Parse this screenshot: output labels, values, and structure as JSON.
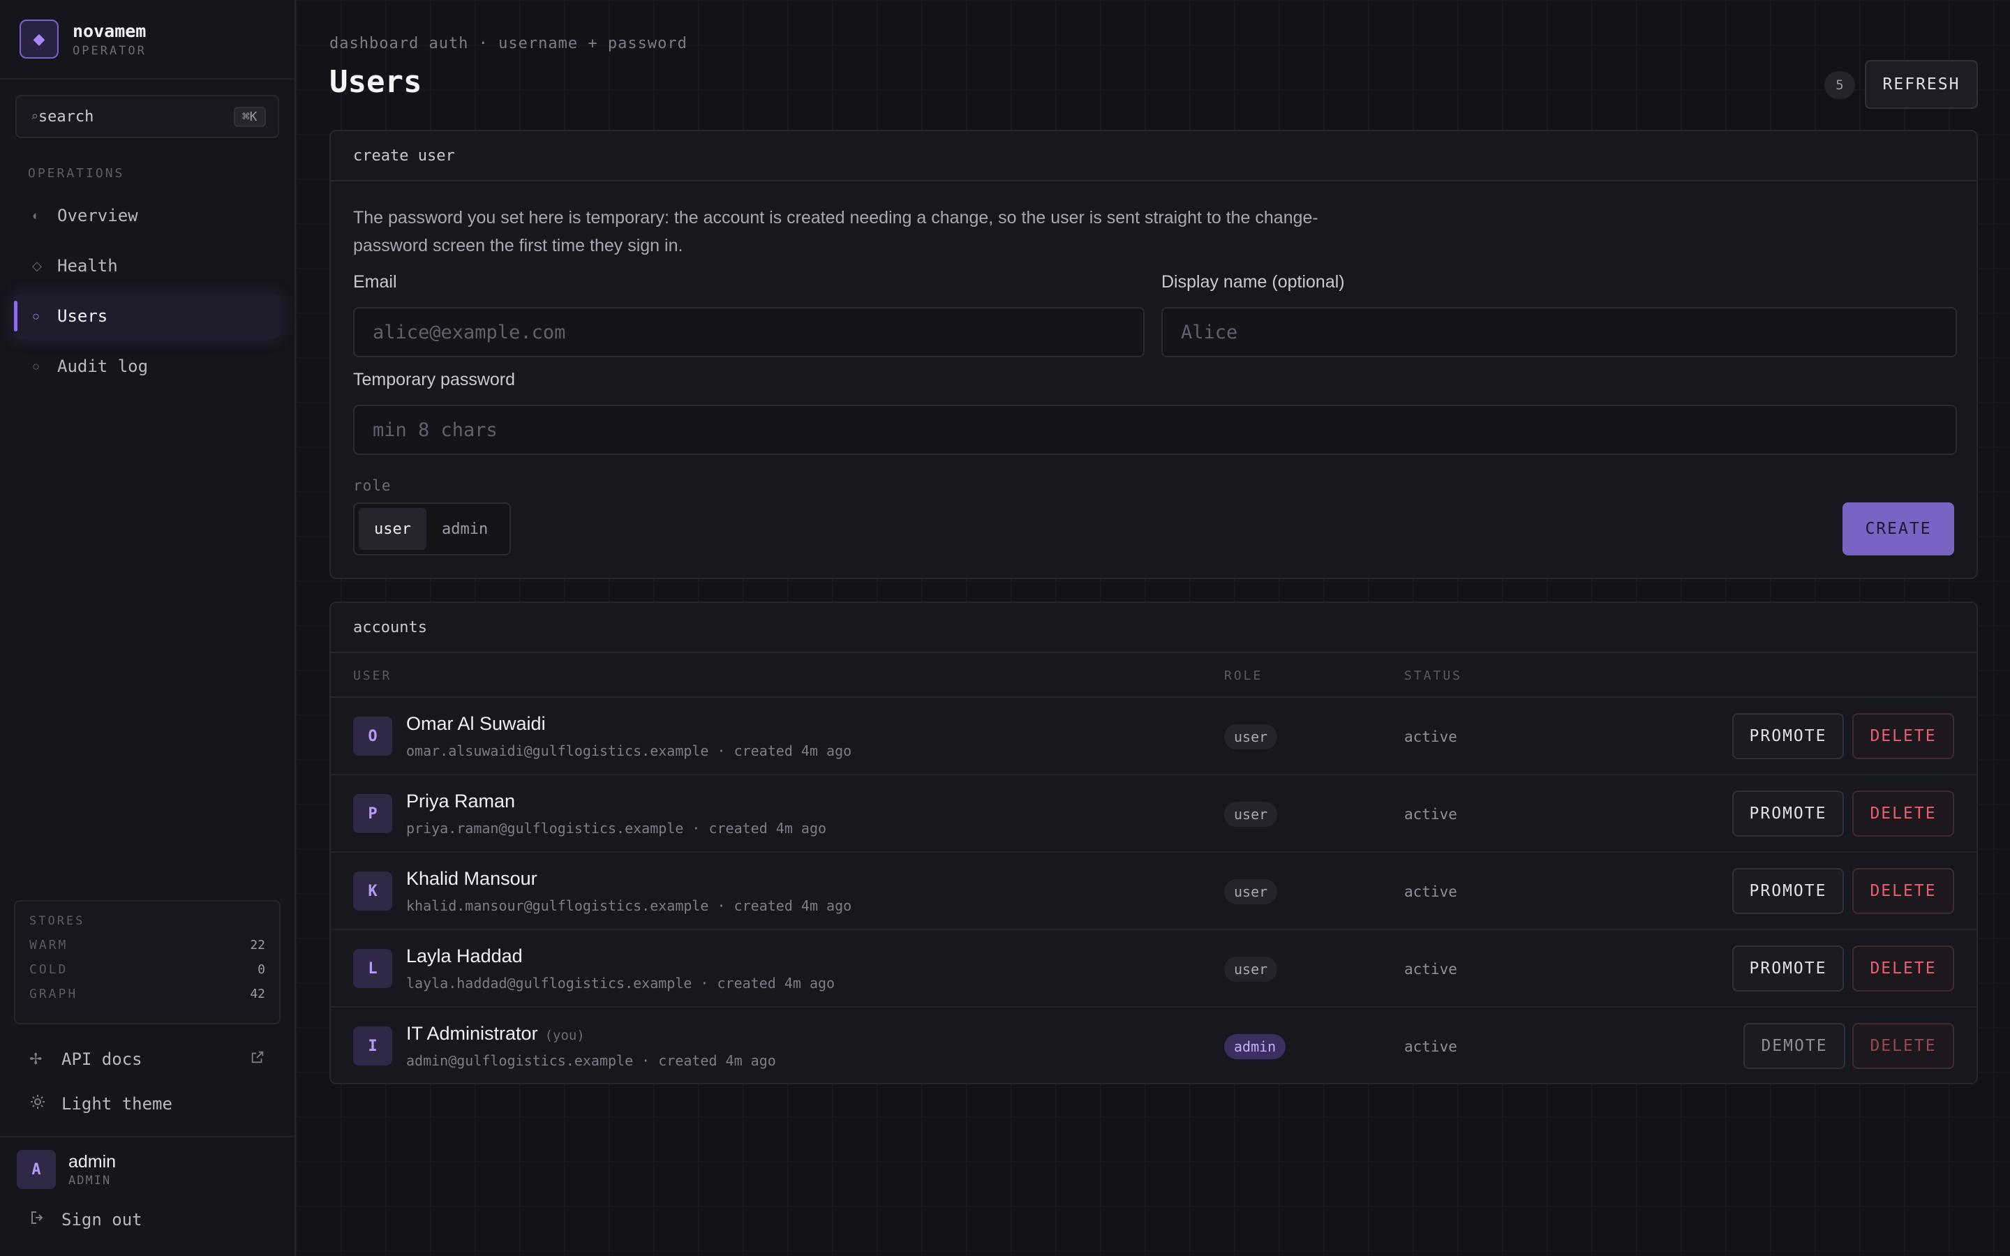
{
  "brand": {
    "name": "novamem",
    "subtitle": "OPERATOR",
    "logo_icon": "diamond-icon"
  },
  "search": {
    "placeholder": "search",
    "shortcut": "⌘K"
  },
  "nav": {
    "section_label": "OPERATIONS",
    "items": [
      {
        "label": "Overview",
        "icon": "half-circle-icon",
        "active": false
      },
      {
        "label": "Health",
        "icon": "diamond-outline-icon",
        "active": false
      },
      {
        "label": "Users",
        "icon": "circle-icon",
        "active": true
      },
      {
        "label": "Audit log",
        "icon": "circle-icon",
        "active": false
      }
    ]
  },
  "stores": {
    "title": "STORES",
    "rows": [
      {
        "key": "WARM",
        "value": "22"
      },
      {
        "key": "COLD",
        "value": "0"
      },
      {
        "key": "GRAPH",
        "value": "42"
      }
    ]
  },
  "sidebar_links": {
    "api_docs": "API docs",
    "theme": "Light theme",
    "sign_out": "Sign out"
  },
  "current_user": {
    "initial": "A",
    "name": "admin",
    "role": "ADMIN"
  },
  "header": {
    "eyebrow": "dashboard auth · username + password",
    "title": "Users",
    "count": "5",
    "refresh_label": "REFRESH"
  },
  "create_user": {
    "card_title": "create user",
    "intro": "The password you set here is temporary: the account is created needing a change, so the user is sent straight to the change-password screen the first time they sign in.",
    "email_label": "Email",
    "email_placeholder": "alice@example.com",
    "display_name_label": "Display name (optional)",
    "display_name_placeholder": "Alice",
    "password_label": "Temporary password",
    "password_placeholder": "min 8 chars",
    "role_label": "role",
    "role_options": [
      "user",
      "admin"
    ],
    "role_selected": "user",
    "create_label": "CREATE"
  },
  "accounts": {
    "card_title": "accounts",
    "columns": {
      "user": "USER",
      "role": "ROLE",
      "status": "STATUS"
    },
    "rows": [
      {
        "initial": "O",
        "name": "Omar Al Suwaidi",
        "you": "",
        "meta": "omar.alsuwaidi@gulflogistics.example · created 4m ago",
        "role": "user",
        "status": "active",
        "primary_action": "PROMOTE",
        "delete": "DELETE"
      },
      {
        "initial": "P",
        "name": "Priya Raman",
        "you": "",
        "meta": "priya.raman@gulflogistics.example · created 4m ago",
        "role": "user",
        "status": "active",
        "primary_action": "PROMOTE",
        "delete": "DELETE"
      },
      {
        "initial": "K",
        "name": "Khalid Mansour",
        "you": "",
        "meta": "khalid.mansour@gulflogistics.example · created 4m ago",
        "role": "user",
        "status": "active",
        "primary_action": "PROMOTE",
        "delete": "DELETE"
      },
      {
        "initial": "L",
        "name": "Layla Haddad",
        "you": "",
        "meta": "layla.haddad@gulflogistics.example · created 4m ago",
        "role": "user",
        "status": "active",
        "primary_action": "PROMOTE",
        "delete": "DELETE"
      },
      {
        "initial": "I",
        "name": "IT Administrator",
        "you": "(you)",
        "meta": "admin@gulflogistics.example · created 4m ago",
        "role": "admin",
        "status": "active",
        "primary_action": "DEMOTE",
        "delete": "DELETE"
      }
    ]
  },
  "colors": {
    "accent": "#8b6ee8",
    "danger": "#ef5d6e",
    "background": "#121319"
  }
}
